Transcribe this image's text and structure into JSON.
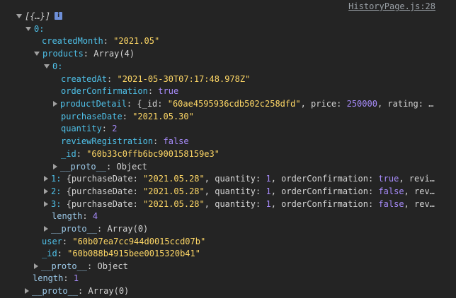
{
  "source_link": "HistoryPage.js:28",
  "root_summary": "[{…}]",
  "info_badge": "i",
  "colors": {
    "background": "#242424",
    "key": "#4fc1e9",
    "string": "#ffd866",
    "number": "#a78bfa",
    "plain": "#d4d4d4"
  },
  "rows": {
    "r1_index": "0:",
    "r2_key": "createdMonth",
    "r2_val": "\"2021.05\"",
    "r3_key": "products",
    "r3_val": "Array(4)",
    "r4_index": "0:",
    "r5_key": "createdAt",
    "r5_val": "\"2021-05-30T07:17:48.978Z\"",
    "r6_key": "orderConfirmation",
    "r6_val": "true",
    "r7_key": "productDetail",
    "r7_a": "{_id: ",
    "r7_id": "\"60ae4595936cdb502c258dfd\"",
    "r7_b": ", price: ",
    "r7_price": "250000",
    "r7_c": ", rating: …",
    "r8_key": "purchaseDate",
    "r8_val": "\"2021.05.30\"",
    "r9_key": "quantity",
    "r9_val": "2",
    "r10_key": "reviewRegistration",
    "r10_val": "false",
    "r11_key": "_id",
    "r11_val": "\"60b33c0ffb6bc900158159e3\"",
    "r12_key": "__proto__",
    "r12_val": "Object",
    "r13_idx": "1:",
    "r13_a": "{purchaseDate: ",
    "r13_date": "\"2021.05.28\"",
    "r13_b": ", quantity: ",
    "r13_q": "1",
    "r13_c": ", orderConfirmation: ",
    "r13_oc": "true",
    "r13_d": ", revi…",
    "r14_idx": "2:",
    "r14_a": "{purchaseDate: ",
    "r14_date": "\"2021.05.28\"",
    "r14_b": ", quantity: ",
    "r14_q": "1",
    "r14_c": ", orderConfirmation: ",
    "r14_oc": "false",
    "r14_d": ", rev…",
    "r15_idx": "3:",
    "r15_a": "{purchaseDate: ",
    "r15_date": "\"2021.05.28\"",
    "r15_b": ", quantity: ",
    "r15_q": "1",
    "r15_c": ", orderConfirmation: ",
    "r15_oc": "false",
    "r15_d": ", rev…",
    "r16_key": "length",
    "r16_val": "4",
    "r17_key": "__proto__",
    "r17_val": "Array(0)",
    "r18_key": "user",
    "r18_val": "\"60b07ea7cc944d0015ccd07b\"",
    "r19_key": "_id",
    "r19_val": "\"60b088b4915bee0015320b41\"",
    "r20_key": "__proto__",
    "r20_val": "Object",
    "r21_key": "length",
    "r21_val": "1",
    "r22_key": "__proto__",
    "r22_val": "Array(0)"
  }
}
